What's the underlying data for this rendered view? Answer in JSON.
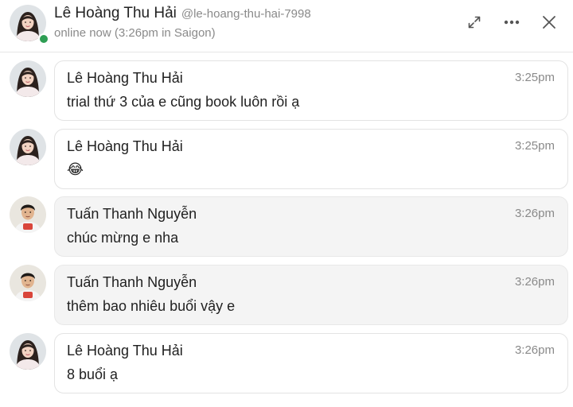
{
  "header": {
    "name": "Lê Hoàng Thu Hải",
    "handle": "@le-hoang-thu-hai-7998",
    "status": "online now (3:26pm in Saigon)",
    "presence_color": "#2e9e54",
    "icons": {
      "expand": "expand-icon",
      "more": "more-options-icon",
      "close": "close-icon"
    }
  },
  "messages": [
    {
      "author": "Lê Hoàng Thu Hải",
      "time": "3:25pm",
      "text": "trial thứ 3 của e cũng book luôn rồi ạ",
      "sender": "thu-hai"
    },
    {
      "author": "Lê Hoàng Thu Hải",
      "time": "3:25pm",
      "text": "😂",
      "sender": "thu-hai"
    },
    {
      "author": "Tuấn Thanh Nguyễn",
      "time": "3:26pm",
      "text": "chúc mừng e nha",
      "sender": "tuan"
    },
    {
      "author": "Tuấn Thanh Nguyễn",
      "time": "3:26pm",
      "text": "thêm bao nhiêu buổi vậy e",
      "sender": "tuan"
    },
    {
      "author": "Lê Hoàng Thu Hải",
      "time": "3:26pm",
      "text": "8 buổi ạ",
      "sender": "thu-hai"
    }
  ]
}
